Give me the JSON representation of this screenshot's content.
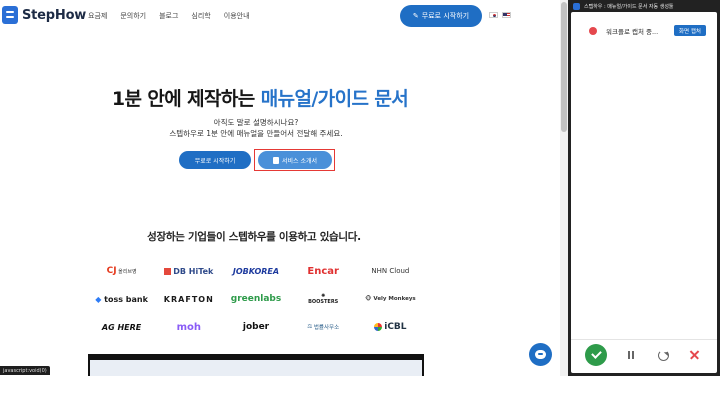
{
  "nav": {
    "brand": "StepHow",
    "menu": [
      "요금제",
      "문의하기",
      "블로그",
      "심리학",
      "이용안내"
    ],
    "cta": "무료로 시작하기",
    "languages": [
      "ko-flag-icon",
      "us-flag-icon"
    ]
  },
  "hero": {
    "title_plain": "1분 안에 제작하는 ",
    "title_highlight": "매뉴얼/가이드 문서",
    "subtitle_line1": "아직도 말로 설명하시나요?",
    "subtitle_line2": "스텝하우로 1분 안에 매뉴얼을 만들어서 전달해 주세요.",
    "primary_button": "무료로 시작하기",
    "secondary_button": "서비스 소개서"
  },
  "clients": {
    "title": "성장하는 기업들이 스텝하우를 이용하고 있습니다.",
    "logos": [
      {
        "id": "cj",
        "text": "CJ",
        "sub": "올리브영"
      },
      {
        "id": "dbhitek",
        "text": "DB HiTek"
      },
      {
        "id": "jobkorea",
        "text": "JOBKOREA"
      },
      {
        "id": "encar",
        "text": "Encar"
      },
      {
        "id": "nhncloud",
        "text": "NHN Cloud"
      },
      {
        "id": "tossbank",
        "text": "toss bank"
      },
      {
        "id": "krafton",
        "text": "KRAFTON"
      },
      {
        "id": "greenlabs",
        "text": "greenlabs"
      },
      {
        "id": "boosters",
        "text": "BOOSTERS"
      },
      {
        "id": "velymonkeys",
        "text": "Vely Monkeys"
      },
      {
        "id": "aghere",
        "text": "AG HERE"
      },
      {
        "id": "moh",
        "text": "moh"
      },
      {
        "id": "jober",
        "text": "jober"
      },
      {
        "id": "lawfirm",
        "text": "법률사무소"
      },
      {
        "id": "icbl",
        "text": "iCBL"
      }
    ]
  },
  "statusbar": {
    "text": "javascript:void(0)"
  },
  "panel": {
    "window_title": "스텝하우 : 매뉴얼/가이드 문서 자동 생성툴",
    "recording_text": "워크플로 캡처 중...",
    "capture_badge": "화면 캡처",
    "controls": [
      "check-icon",
      "pause-icon",
      "restart-icon",
      "close-icon"
    ],
    "colors": {
      "recording": "#e5484d",
      "confirm": "#2e9b4a",
      "accent": "#1f6ec4"
    }
  }
}
